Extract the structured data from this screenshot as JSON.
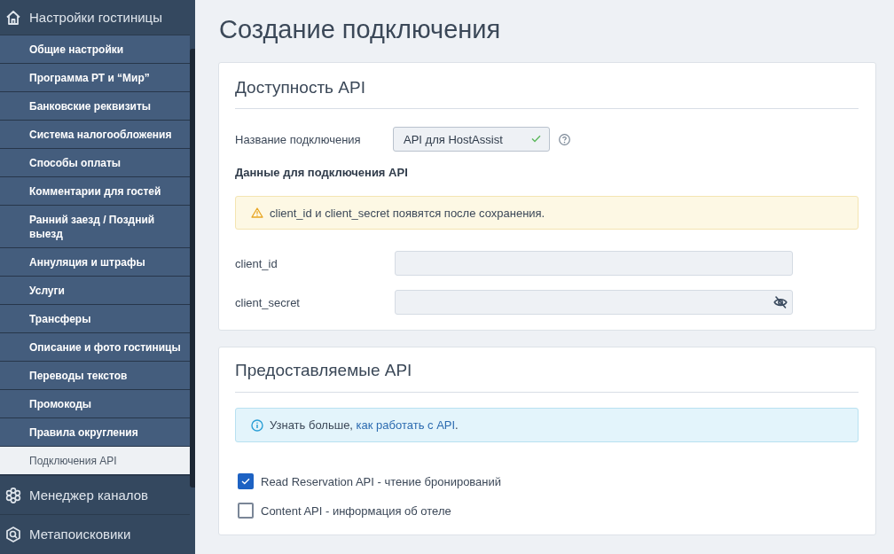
{
  "sidebar": {
    "sections": [
      {
        "label": "Настройки гостиницы",
        "items": [
          {
            "label": "Общие настройки",
            "selected": false
          },
          {
            "label": "Программа РТ и “Мир”",
            "selected": false
          },
          {
            "label": "Банковские реквизиты",
            "selected": false
          },
          {
            "label": "Система налогообложения",
            "selected": false
          },
          {
            "label": "Способы оплаты",
            "selected": false
          },
          {
            "label": "Комментарии для гостей",
            "selected": false
          },
          {
            "label": "Ранний заезд / Поздний выезд",
            "selected": false
          },
          {
            "label": "Аннуляция и штрафы",
            "selected": false
          },
          {
            "label": "Услуги",
            "selected": false
          },
          {
            "label": "Трансферы",
            "selected": false
          },
          {
            "label": "Описание и фото гостиницы",
            "selected": false
          },
          {
            "label": "Переводы текстов",
            "selected": false
          },
          {
            "label": "Промокоды",
            "selected": false
          },
          {
            "label": "Правила округления",
            "selected": false
          },
          {
            "label": "Подключения API",
            "selected": true
          }
        ]
      },
      {
        "label": "Менеджер каналов"
      },
      {
        "label": "Метапоисковики"
      }
    ]
  },
  "page": {
    "title": "Создание подключения"
  },
  "availability": {
    "title": "Доступность API",
    "name_field": {
      "label": "Название подключения",
      "value": "API для HostAssist",
      "valid": true
    },
    "subheading": "Данные для подключения API",
    "alert": {
      "kind": "warning",
      "text": "client_id и client_secret появятся после сохранения."
    },
    "credentials": [
      {
        "label": "client_id",
        "kind": "plain"
      },
      {
        "label": "client_secret",
        "kind": "secret"
      }
    ]
  },
  "provided": {
    "title": "Предоставляемые API",
    "alert": {
      "kind": "info",
      "text": "Узнать больше, ",
      "link": "как работать с API",
      "suffix": "."
    },
    "options": [
      {
        "label": "Read Reservation API - чтение бронирований",
        "checked": true
      },
      {
        "label": "Content API - информация об отеле",
        "checked": false
      }
    ]
  }
}
